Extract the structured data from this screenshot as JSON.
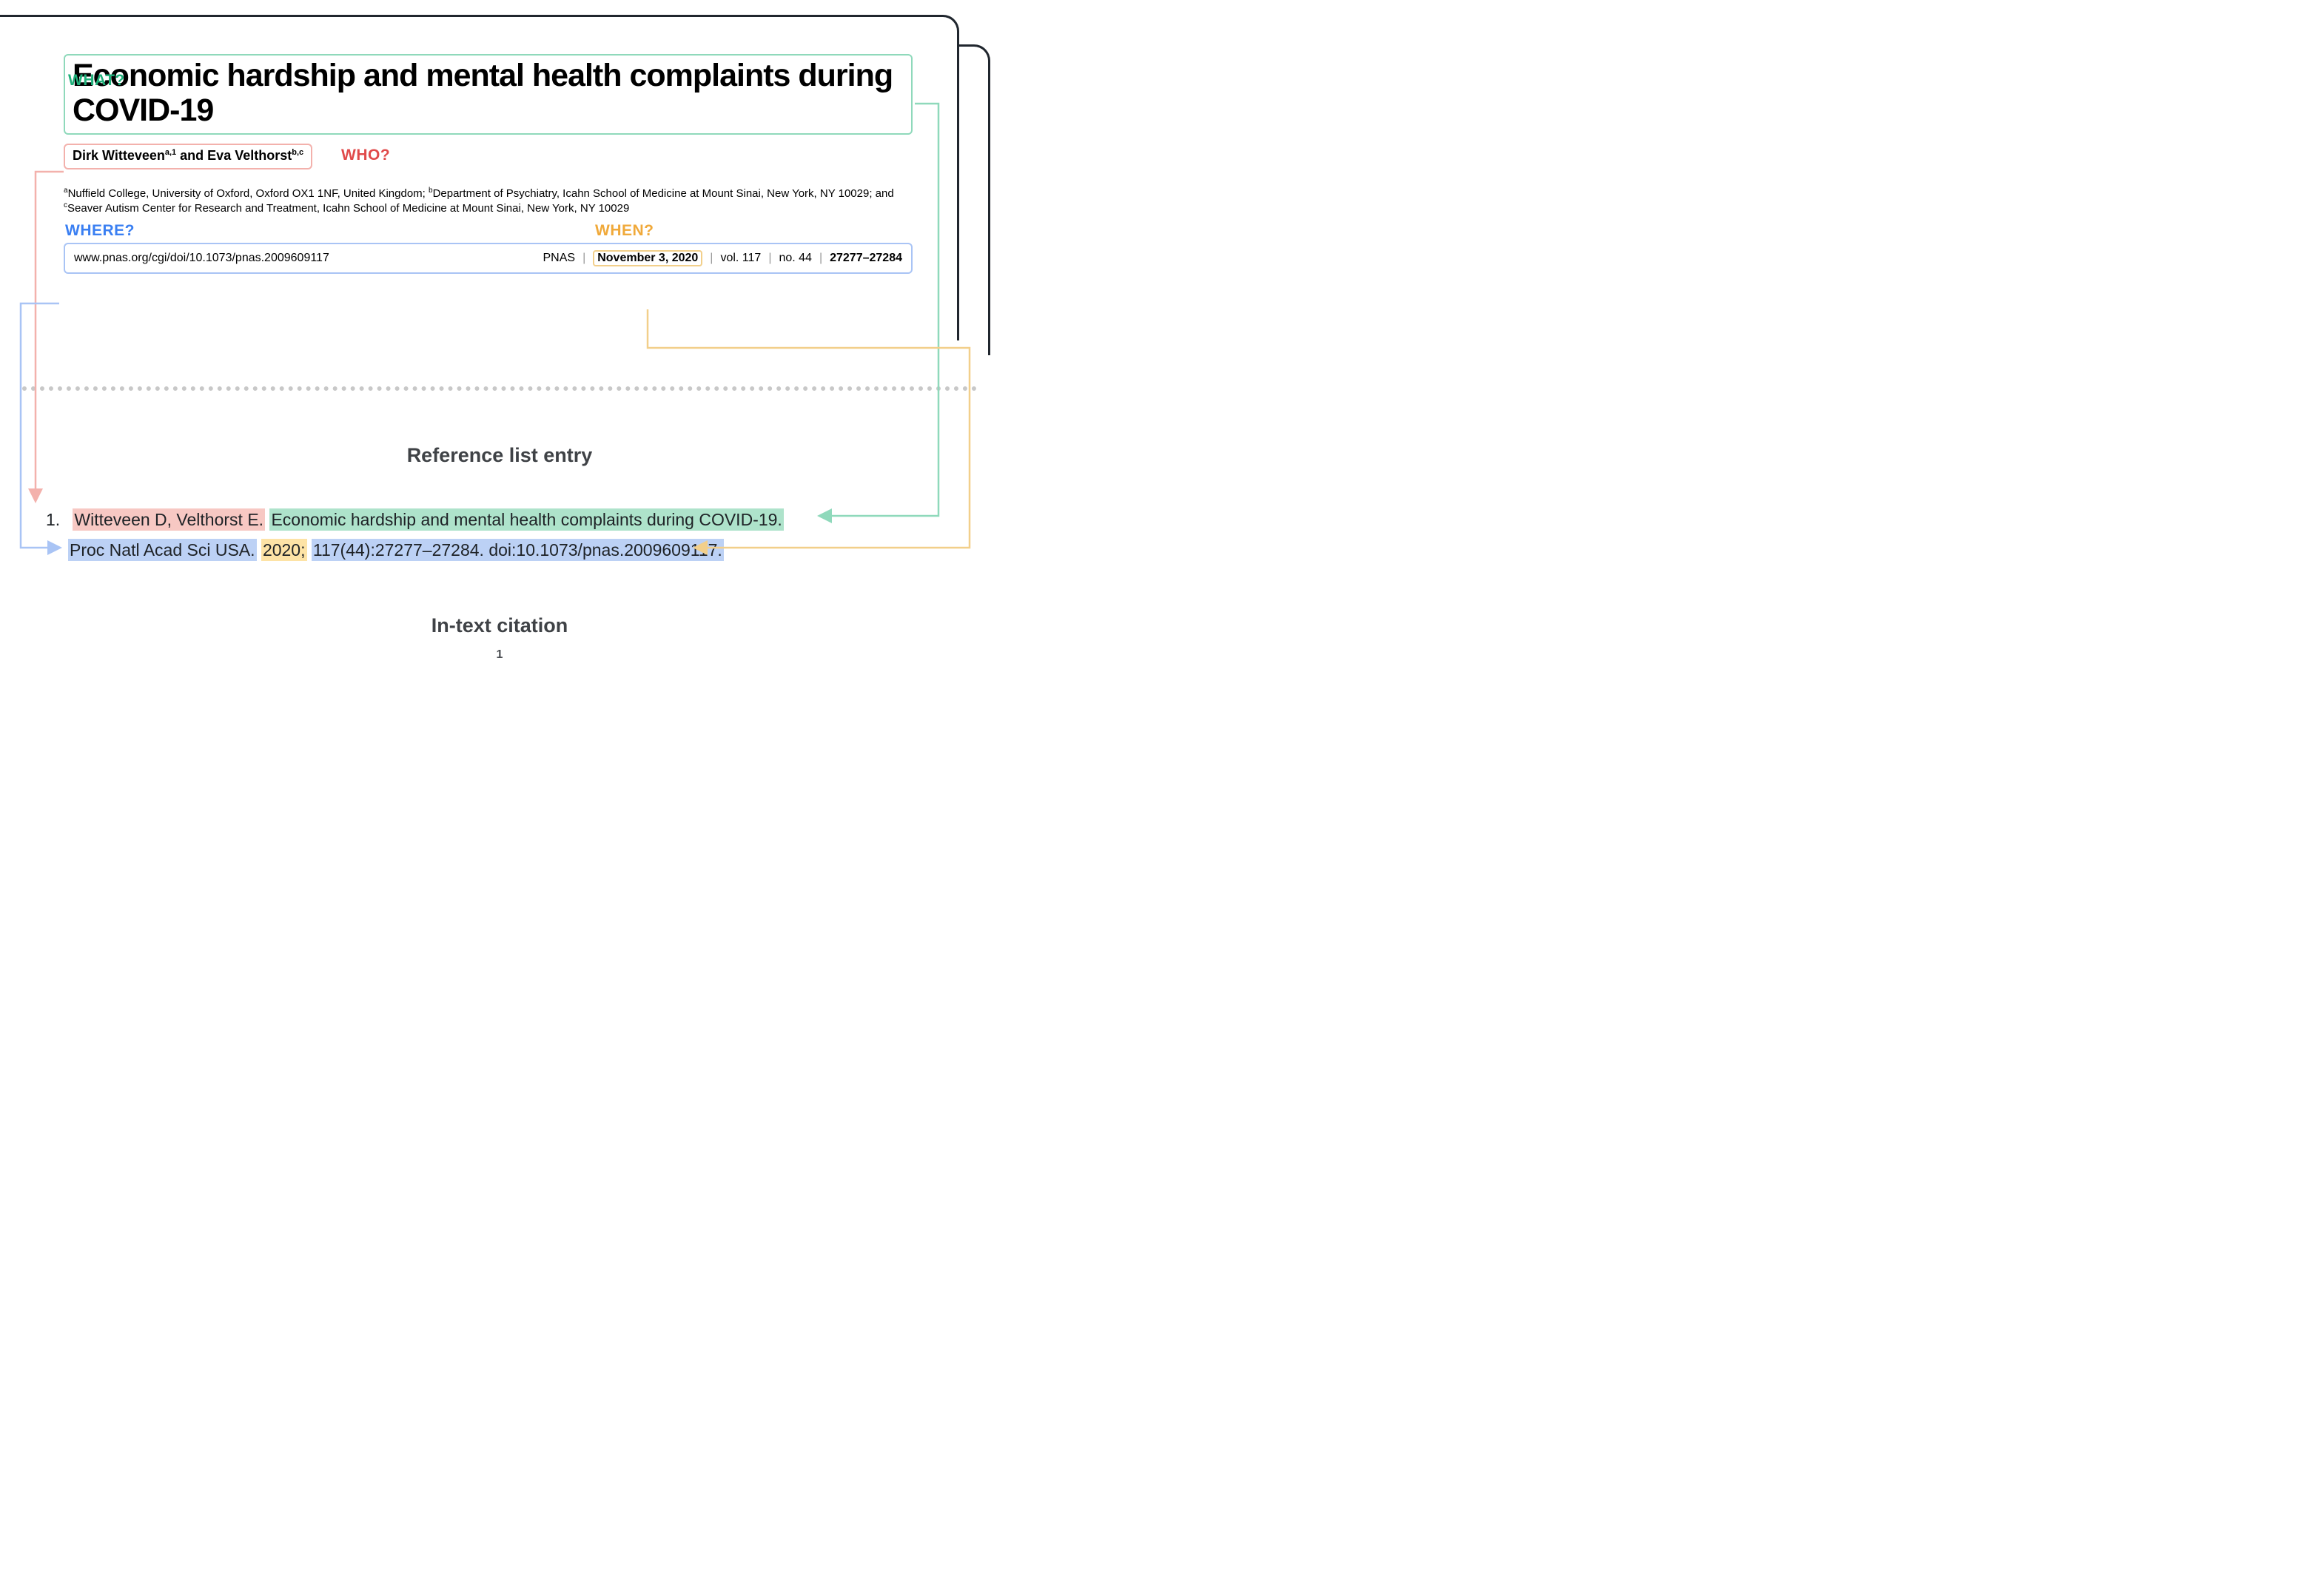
{
  "labels": {
    "what": "WHAT?",
    "who": "WHO?",
    "where": "WHERE?",
    "when": "WHEN?"
  },
  "paper": {
    "title": "Economic hardship and mental health complaints during COVID-19",
    "authors_html": "Dirk Witteveen<sup>a,1</sup> and Eva Velthorst<sup>b,c</sup>",
    "affiliations_html": "<sup>a</sup>Nuffield College, University of Oxford, Oxford OX1 1NF, United Kingdom; <sup>b</sup>Department of Psychiatry, Icahn School of Medicine at Mount Sinai, New York, NY 10029; and <sup>c</sup>Seaver Autism Center for Research and Treatment, Icahn School of Medicine at Mount Sinai, New York, NY 10029",
    "doi_url": "www.pnas.org/cgi/doi/10.1073/pnas.2009609117",
    "journal": "PNAS",
    "date": "November 3, 2020",
    "volume": "vol. 117",
    "issue": "no. 44",
    "pages": "27277–27284"
  },
  "sections": {
    "reference_heading": "Reference list entry",
    "citation_heading": "In-text citation",
    "page_number": "1"
  },
  "reference": {
    "number": "1.",
    "authors": "Witteveen D, Velthorst E.",
    "title": "Economic hardship and mental health complaints during COVID-19.",
    "journal_abbrev": "Proc Natl Acad Sci USA.",
    "year": "2020;",
    "locator": "117(44):27277–27284. doi:10.1073/pnas.2009609117."
  }
}
